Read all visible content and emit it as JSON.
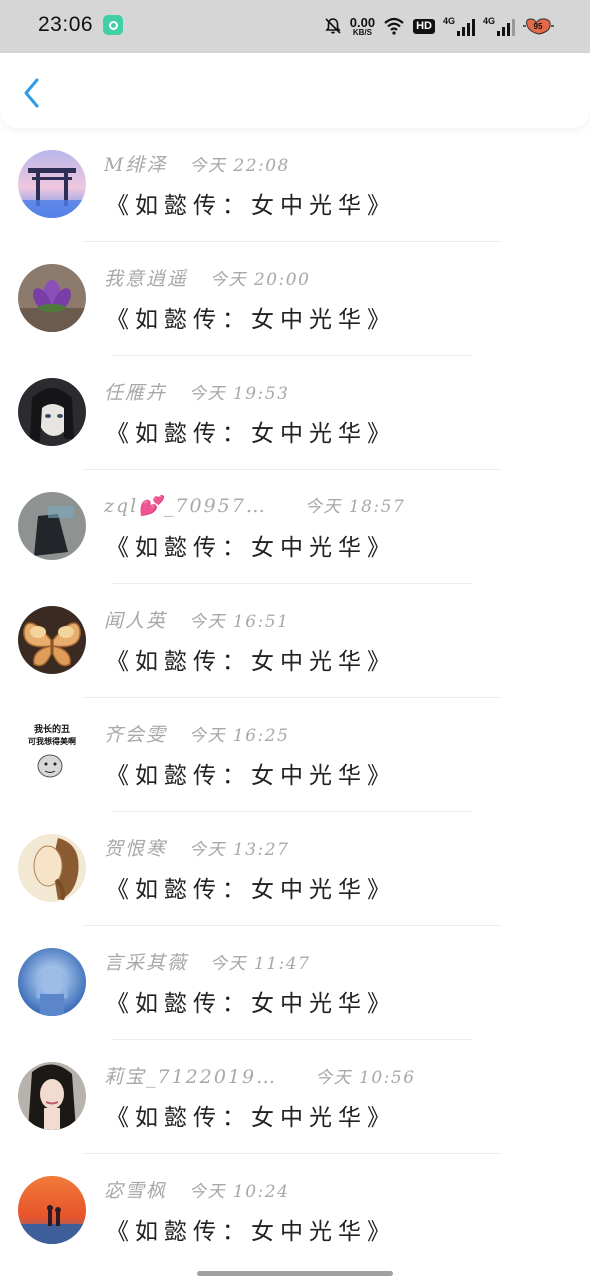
{
  "status_bar": {
    "time": "23:06",
    "net_speed_value": "0.00",
    "net_speed_unit": "KB/S",
    "hd_badge": "HD",
    "sim1_label": "4G",
    "sim2_label": "4G",
    "battery_percent": "95"
  },
  "header": {
    "back_icon": "chevron-left-icon",
    "accent_color": "#2e9be6"
  },
  "messages": [
    {
      "name": "M绯泽",
      "time": "今天 22:08",
      "title": "《如懿传：女中光华》"
    },
    {
      "name": "我意逍遥",
      "time": "今天 20:00",
      "title": "《如懿传：女中光华》"
    },
    {
      "name": "任雁卉",
      "time": "今天 19:53",
      "title": "《如懿传：女中光华》"
    },
    {
      "name": "zql💕_70957…",
      "time": "今天 18:57",
      "title": "《如懿传：女中光华》"
    },
    {
      "name": "闻人英",
      "time": "今天 16:51",
      "title": "《如懿传：女中光华》"
    },
    {
      "name": "齐会雯",
      "time": "今天 16:25",
      "title": "《如懿传：女中光华》",
      "avatar_text_1": "我长的丑",
      "avatar_text_2": "可我想得美啊"
    },
    {
      "name": "贺恨寒",
      "time": "今天 13:27",
      "title": "《如懿传：女中光华》"
    },
    {
      "name": "言采其薇",
      "time": "今天 11:47",
      "title": "《如懿传：女中光华》"
    },
    {
      "name": "莉宝_7122019…",
      "time": "今天 10:56",
      "title": "《如懿传：女中光华》"
    },
    {
      "name": "宓雪枫",
      "time": "今天 10:24",
      "title": "《如懿传：女中光华》"
    }
  ]
}
